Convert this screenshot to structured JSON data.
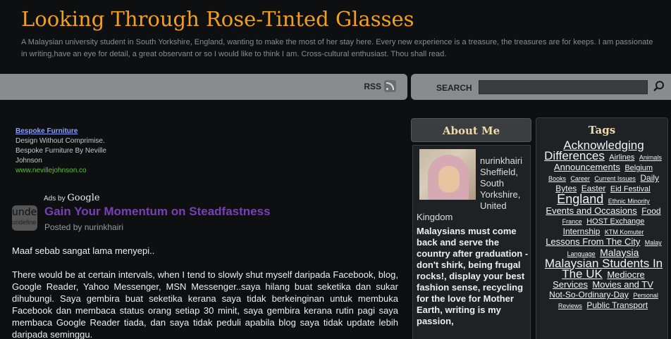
{
  "blog": {
    "title": "Looking Through Rose-Tinted Glasses",
    "description": "A Malaysian university student in South Yorkshire, England, wanting to make the most of her stay here. Every new experience is a treasure, the treasures are for keeps. I am passionate in writing,have an eye for detail, a great observant or so I would like to think I am. Cross-cultural enthusiast. Thou shall read."
  },
  "navbar": {
    "rss_label": "RSS",
    "search_label": "SEARCH",
    "search_value": "",
    "icons": [
      "rss-icon",
      "search-icon"
    ]
  },
  "ad": {
    "link": "Bespoke Furniture",
    "text": "Design Without Comprimise. Bespoke Furniture By Neville Johnson",
    "url": "www.nevillejohnson.co",
    "ads_by": "Ads by",
    "google": "Google"
  },
  "post": {
    "avatar_line1": "unde",
    "avatar_line2": "undefine",
    "title": "Gain Your Momentum on Steadfastness",
    "byline": "Posted by nurinkhairi",
    "paragraphs": [
      "Maaf sebab sangat lama menyepi..",
      "There would be at certain intervals, when I tend to slowly shut myself daripada Facebook, blog, Google Reader, Yahoo Messenger, MSN Messenger..saya hilang buat seketika dan sukar dihubungi. Saya gembira buat seketika kerana saya tidak berkeinginan untuk membuka Facebook dan membaca status orang setiap 30 minit, saya gembira kerana rutin pagi saya membaca Google Reader tiada, dan saya tidak peduli apabila blog saya tidak update lebih daripada seminggu."
    ]
  },
  "about": {
    "heading": "About Me",
    "name_loc": "nurinkhairi Sheffield, South Yorkshire, United",
    "loc_end": "Kingdom",
    "bio": "Malaysians must come back and serve the country after graduation - don't shirk, being frugal rocks!, display your best fashion sense, recycling for the love for Mother Earth, writing is my passion,"
  },
  "tags": {
    "heading": "Tags",
    "items": [
      {
        "label": "Acknowledging Differences",
        "size": 17
      },
      {
        "label": "Airlines",
        "size": 11
      },
      {
        "label": "Animals",
        "size": 9
      },
      {
        "label": "Announcements",
        "size": 13
      },
      {
        "label": "Belgium",
        "size": 11
      },
      {
        "label": "Books",
        "size": 9
      },
      {
        "label": "Career",
        "size": 9
      },
      {
        "label": "Current Issues",
        "size": 9
      },
      {
        "label": "Daily Bytes",
        "size": 12
      },
      {
        "label": "Easter",
        "size": 12
      },
      {
        "label": "Eid Festival",
        "size": 11
      },
      {
        "label": "England",
        "size": 18
      },
      {
        "label": "Ethnic Minority",
        "size": 9
      },
      {
        "label": "Events and Occasions",
        "size": 13
      },
      {
        "label": "Food",
        "size": 12
      },
      {
        "label": "France",
        "size": 9
      },
      {
        "label": "HOST Exchange",
        "size": 11
      },
      {
        "label": "Internship",
        "size": 12
      },
      {
        "label": "KTM Komuter",
        "size": 9
      },
      {
        "label": "Lessons From The City",
        "size": 13
      },
      {
        "label": "Malay Language",
        "size": 9
      },
      {
        "label": "Malaysia",
        "size": 14
      },
      {
        "label": "Malaysian Students In The UK",
        "size": 17
      },
      {
        "label": "Mediocre Services",
        "size": 13
      },
      {
        "label": "Movies and TV",
        "size": 13
      },
      {
        "label": "Not-So-Ordinary-Day",
        "size": 12
      },
      {
        "label": "Personal Reviews",
        "size": 9
      },
      {
        "label": "Public Transport",
        "size": 12
      }
    ]
  }
}
